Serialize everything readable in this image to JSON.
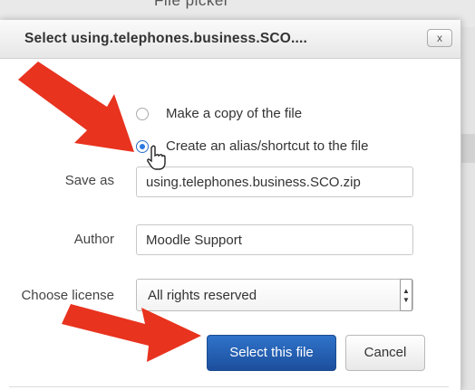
{
  "background": {
    "title": "File picker"
  },
  "dialog": {
    "title": "Select using.telephones.business.SCO....",
    "close_label": "x"
  },
  "options": {
    "copy_label": "Make a copy of the file",
    "alias_label": "Create an alias/shortcut to the file",
    "selected": "alias"
  },
  "form": {
    "save_as_label": "Save as",
    "save_as_value": "using.telephones.business.SCO.zip",
    "author_label": "Author",
    "author_value": "Moodle Support",
    "license_label": "Choose license",
    "license_value": "All rights reserved"
  },
  "buttons": {
    "select_label": "Select this file",
    "cancel_label": "Cancel"
  },
  "colors": {
    "primary": "#1c4f9d",
    "arrow": "#e8331f",
    "radio_selected": "#2a7ae2"
  },
  "icons": [
    "close-icon",
    "arrow-icon",
    "hand-cursor-icon",
    "caret-icon"
  ]
}
